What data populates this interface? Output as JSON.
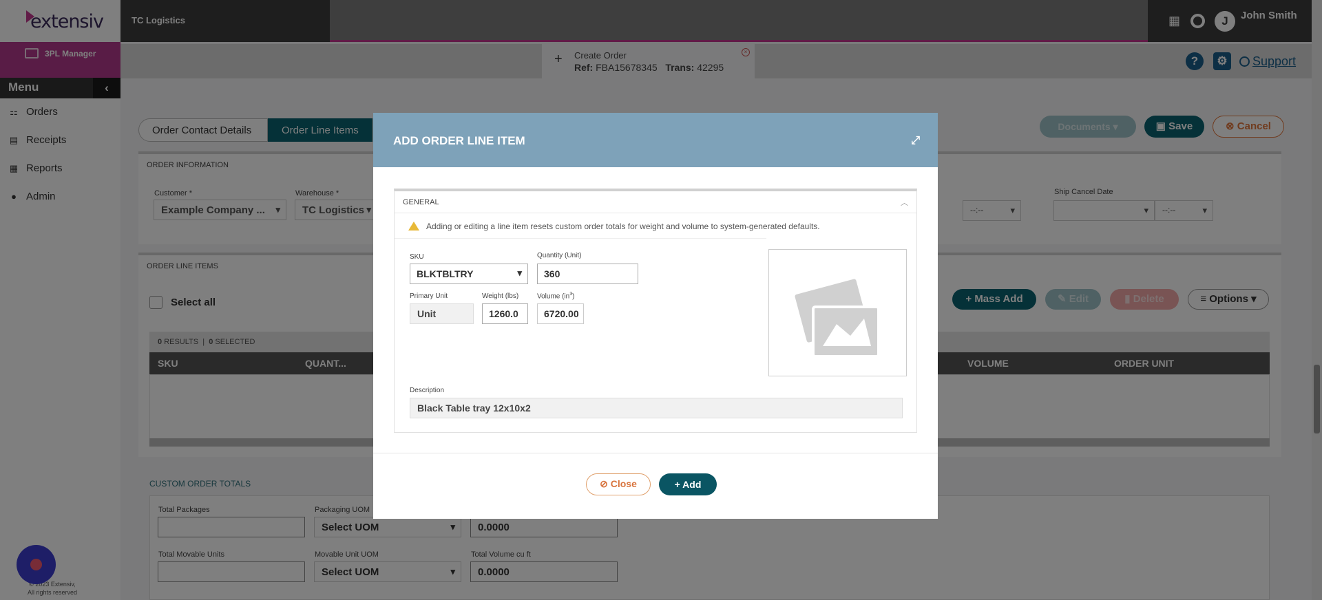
{
  "brand": {
    "logo_text": "extensiv",
    "org_name": "TC Logistics",
    "app_name": "3PL Manager"
  },
  "user": {
    "initial": "J",
    "name": "John Smith"
  },
  "menu": {
    "title": "Menu",
    "items": [
      {
        "label": "Orders",
        "icon": "sitemap-icon"
      },
      {
        "label": "Receipts",
        "icon": "document-icon"
      },
      {
        "label": "Reports",
        "icon": "report-icon"
      },
      {
        "label": "Admin",
        "icon": "user-icon"
      }
    ]
  },
  "footer": {
    "line1": "© 2023 Extensiv,",
    "line2": "All rights reserved"
  },
  "order_tab": {
    "title": "Create Order",
    "ref_label": "Ref:",
    "ref_value": "FBA15678345",
    "trans_label": "Trans:",
    "trans_value": "42295"
  },
  "header_links": {
    "support": "Support"
  },
  "page_tabs": [
    "Order Contact Details",
    "Order Line Items"
  ],
  "page_actions": {
    "documents": "Documents",
    "save": "Save",
    "cancel": "Cancel"
  },
  "order_info": {
    "section_title": "ORDER INFORMATION",
    "customer_label": "Customer *",
    "customer_value": "Example Company ...",
    "warehouse_label": "Warehouse *",
    "warehouse_value": "TC Logistics",
    "ship_cancel_label": "Ship Cancel Date",
    "time_placeholder": "--:--"
  },
  "line_items": {
    "section_title": "ORDER LINE ITEMS",
    "select_all": "Select all",
    "results_count": "0",
    "results_label": "RESULTS",
    "selected_count": "0",
    "selected_label": "SELECTED",
    "columns": [
      "SKU",
      "QUANT...",
      "VOLUME",
      "ORDER UNIT"
    ],
    "buttons": {
      "mass_add": "Mass Add",
      "edit": "Edit",
      "delete": "Delete",
      "options": "Options"
    }
  },
  "custom_totals": {
    "section_title": "CUSTOM ORDER TOTALS",
    "total_packages_label": "Total Packages",
    "packaging_uom_label": "Packaging UOM",
    "packaging_uom_value": "Select UOM",
    "weight_value": "0.0000",
    "total_movable_label": "Total Movable Units",
    "movable_uom_label": "Movable Unit UOM",
    "movable_uom_value": "Select UOM",
    "total_volume_label": "Total Volume cu ft",
    "volume_value": "0.0000"
  },
  "modal": {
    "title": "ADD ORDER LINE ITEM",
    "general_title": "GENERAL",
    "warning": "Adding or editing a line item resets custom order totals for weight and volume to system-generated defaults.",
    "sku_label": "SKU",
    "sku_value": "BLKTBLTRY",
    "quantity_label": "Quantity (Unit)",
    "quantity_value": "360",
    "primary_unit_label": "Primary Unit",
    "primary_unit_value": "Unit",
    "weight_label": "Weight (lbs)",
    "weight_value": "1260.0",
    "volume_label": "Volume (in",
    "volume_label_sup": "3",
    "volume_label_close": ")",
    "volume_value": "6720.00",
    "description_label": "Description",
    "description_value": "Black Table tray 12x10x2",
    "close_button": "Close",
    "add_button": "Add"
  },
  "colors": {
    "accent": "#0a6370",
    "brand_pink": "#c2378f",
    "modal_header": "#7ea2b9",
    "cancel": "#e0763c"
  }
}
